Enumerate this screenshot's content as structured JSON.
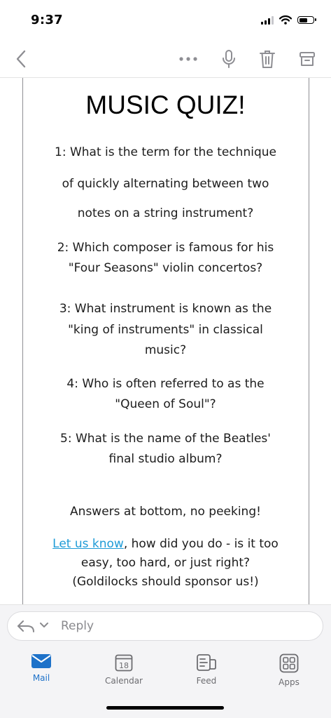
{
  "status_bar": {
    "time": "9:37"
  },
  "toolbar": {
    "back_icon": "chevron-left-icon",
    "more_icon": "ellipsis-icon",
    "mic_icon": "microphone-icon",
    "delete_icon": "trash-icon",
    "archive_icon": "archive-icon"
  },
  "email": {
    "title": "MUSIC QUIZ!",
    "questions": [
      {
        "lines": [
          "1: What is the term for the technique",
          "of quickly alternating between two",
          "notes on a string instrument?"
        ]
      },
      {
        "lines": [
          "2: Which composer is famous for his",
          "\"Four Seasons\" violin concertos?"
        ]
      },
      {
        "lines": [
          "3: What instrument is known as the",
          "\"king of instruments\" in classical",
          "music?"
        ]
      },
      {
        "lines": [
          "4: Who is often referred to as the",
          "\"Queen of Soul\"?"
        ]
      },
      {
        "lines": [
          "5: What is the name of the Beatles'",
          "final studio album?"
        ]
      }
    ],
    "answers_note": "Answers at bottom, no peeking!",
    "feedback": {
      "link_text": "Let us know",
      "line1_rest": ", how did you do - is it too",
      "line2": "easy, too hard, or just right?",
      "line3": "(Goldilocks should sponsor us!)"
    },
    "link_color": "#1e9bd7"
  },
  "reply": {
    "placeholder": "Reply"
  },
  "tabs": [
    {
      "label": "Mail",
      "icon": "mail-icon",
      "active": true
    },
    {
      "label": "Calendar",
      "icon": "calendar-icon",
      "badge": "18"
    },
    {
      "label": "Feed",
      "icon": "feed-icon"
    },
    {
      "label": "Apps",
      "icon": "apps-grid-icon"
    }
  ],
  "accent_color": "#1e72c9"
}
